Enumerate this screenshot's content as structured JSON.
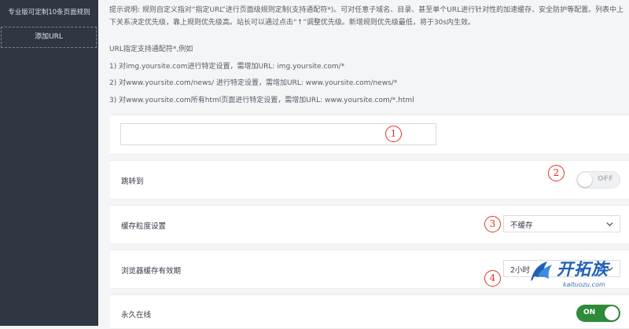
{
  "sidebar": {
    "title": "专业版可定制10条页面规则",
    "add_url": "添加URL"
  },
  "tips": {
    "description": "提示说明: 规则自定义指对“指定URL”进行页面级规则定制(支持通配符*)。可对任意子域名、目录、甚至单个URL进行针对性的加速缓存、安全防护等配置。列表中上下关系决定优先级，靠上规则优先级高。站长可以通过点击“↑”调整优先级。新增规则优先级最低，将于30s内生效。",
    "wildcard_title": "URL指定支持通配符*,例如",
    "examples": [
      "1) 对img.yoursite.com进行特定设置，需增加URL: img.yoursite.com/*",
      "2) 对www.yoursite.com/news/ 进行特定设置，需增加URL: www.yoursite.com/news/*",
      "3) 对www.yoursite.com所有html页面进行特定设置，需增加URL: www.yoursite.com/*.html"
    ]
  },
  "form": {
    "url_value": "",
    "url_placeholder": "",
    "redirect_label": "跳转到",
    "redirect_toggle": "OFF",
    "cache_label": "缓存粒度设置",
    "cache_value": "不缓存",
    "browser_cache_label": "浏览器缓存有效期",
    "browser_cache_value": "2小时",
    "always_online_label": "永久在线",
    "always_online_toggle": "ON"
  },
  "markers": [
    "1",
    "2",
    "3",
    "4"
  ],
  "watermark": {
    "name": "开拓族",
    "url": "kaituozu.com"
  },
  "colors": {
    "sidebar_bg": "#2f3742",
    "toggle_on": "#2e8b3a",
    "marker_red": "#e4312b",
    "watermark_blue": "#1f5fb8"
  }
}
